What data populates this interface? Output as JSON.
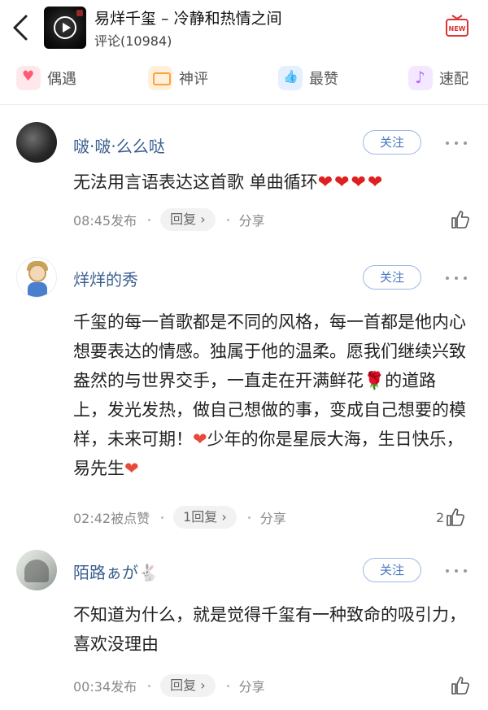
{
  "header": {
    "song_title": "易烊千玺 – 冷静和热情之间",
    "comment_count": "评论(10984)",
    "new_label": "NEW"
  },
  "tabs": [
    {
      "label": "偶遇",
      "icon": "heart-message-icon"
    },
    {
      "label": "神评",
      "icon": "chat-icon"
    },
    {
      "label": "最赞",
      "icon": "thumbs-up-icon"
    },
    {
      "label": "速配",
      "icon": "music-note-icon"
    }
  ],
  "comments": [
    {
      "username": "啵·啵·么么哒",
      "follow_label": "关注",
      "text": "无法用言语表达这首歌 单曲循环",
      "hearts": "❤❤❤❤",
      "time": "08:45发布",
      "reply_label": "回复 ›",
      "share_label": "分享",
      "like_count": ""
    },
    {
      "username": "烊烊的秀",
      "follow_label": "关注",
      "text_part1": "千玺的每一首歌都是不同的风格，每一首都是他内心想要表达的情感。独属于他的温柔。愿我们继续兴致盎然的与世界交手，一直走在开满鲜花",
      "rose": "🌹",
      "text_part2": "的道路上，发光发热，做自己想做的事，变成自己想要的模样，未来可期！",
      "heart": "❤",
      "text_part3": "少年的你是星辰大海，生日快乐，易先生",
      "time": "02:42被点赞",
      "reply_label": "1回复 ›",
      "share_label": "分享",
      "like_count": "2"
    },
    {
      "username": "陌路ぁが",
      "username_emoji": "🐇",
      "follow_label": "关注",
      "text": "不知道为什么，就是觉得千玺有一种致命的吸引力，喜欢没理由",
      "time": "00:34发布",
      "reply_label": "回复 ›",
      "share_label": "分享",
      "like_count": ""
    }
  ]
}
